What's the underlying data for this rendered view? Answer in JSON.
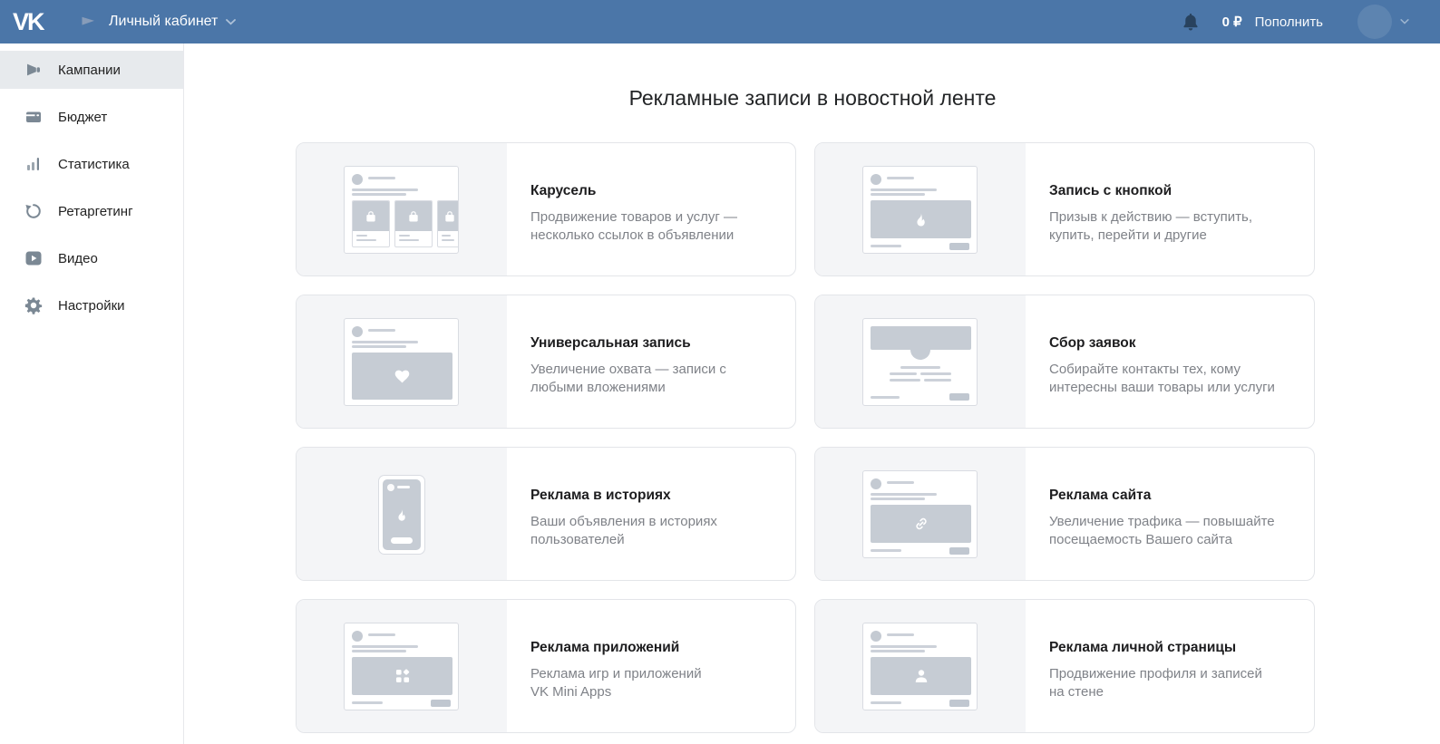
{
  "topbar": {
    "brand": "VK",
    "workspace_label": "Личный кабинет",
    "balance": "0 ₽",
    "topup_label": "Пополнить",
    "icons": [
      "vk-logo",
      "flag-icon",
      "chevron-down-icon",
      "bell-icon",
      "avatar",
      "chevron-down-icon"
    ]
  },
  "sidebar": {
    "items": [
      {
        "label": "Кампании",
        "icon": "megaphone-icon",
        "active": true
      },
      {
        "label": "Бюджет",
        "icon": "wallet-icon",
        "active": false
      },
      {
        "label": "Статистика",
        "icon": "bar-chart-icon",
        "active": false
      },
      {
        "label": "Ретаргетинг",
        "icon": "undo-arrow-icon",
        "active": false
      },
      {
        "label": "Видео",
        "icon": "video-icon",
        "active": false
      },
      {
        "label": "Настройки",
        "icon": "gear-icon",
        "active": false
      }
    ]
  },
  "main": {
    "title": "Рекламные записи в новостной ленте",
    "cards": [
      {
        "title": "Карусель",
        "desc": "Продвижение товаров и услуг —\nнесколько ссылок в объявлении",
        "illustration": "carousel-post"
      },
      {
        "title": "Запись с кнопкой",
        "desc": "Призыв к действию — вступить,\nкупить, перейти и другие",
        "illustration": "post-flame-button"
      },
      {
        "title": "Универсальная запись",
        "desc": "Увеличение охвата — записи с\nлюбыми вложениями",
        "illustration": "post-heart"
      },
      {
        "title": "Сбор заявок",
        "desc": "Собирайте контакты тех, кому\nинтересны ваши товары или услуги",
        "illustration": "lead-form"
      },
      {
        "title": "Реклама в историях",
        "desc": "Ваши объявления в историях\nпользователей",
        "illustration": "story-phone-flame"
      },
      {
        "title": "Реклама сайта",
        "desc": "Увеличение трафика — повышайте\nпосещаемость Вашего сайта",
        "illustration": "post-link-button"
      },
      {
        "title": "Реклама приложений",
        "desc": "Реклама игр и приложений\nVK Mini Apps",
        "illustration": "post-apps-button"
      },
      {
        "title": "Реклама личной страницы",
        "desc": "Продвижение профиля и записей\nна стене",
        "illustration": "post-person-button"
      }
    ]
  },
  "colors": {
    "topbar_blue": "#4b76a8",
    "bell_dark": "#28425e",
    "sidebar_active_bg": "#e7eaed",
    "icon_gray": "#7b8894",
    "card_border": "#e3e5e9",
    "illustration_bg": "#f4f5f7",
    "mock_gray": "#c6ccd4",
    "description_text": "#7f8288"
  }
}
